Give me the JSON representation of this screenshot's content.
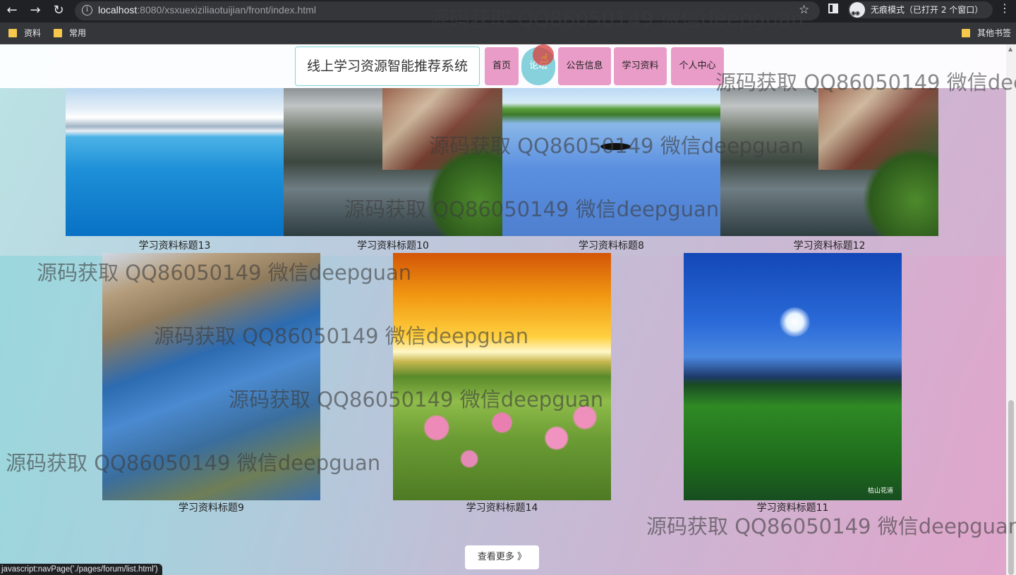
{
  "browser": {
    "url_host": "localhost",
    "url_path": ":8080/xsxuexiziliaotuijian/front/index.html",
    "incognito_label": "无痕模式（已打开 2 个窗口）",
    "bookmarks": [
      "资料",
      "常用"
    ],
    "other_bookmarks": "其他书签",
    "status_text": "javascript:navPage('./pages/forum/list.html')"
  },
  "site": {
    "title": "线上学习资源智能推荐系统",
    "nav": [
      {
        "label": "首页",
        "active": false
      },
      {
        "label": "论坛",
        "active": true
      },
      {
        "label": "公告信息",
        "active": false
      },
      {
        "label": "学习资料",
        "active": false
      },
      {
        "label": "个人中心",
        "active": false
      }
    ]
  },
  "gallery": {
    "row1": [
      {
        "caption": "学习资料标题13",
        "image": "snowy-mountain-lake"
      },
      {
        "caption": "学习资料标题10",
        "image": "lakeside-village"
      },
      {
        "caption": "学习资料标题8",
        "image": "blue-lake-boat"
      },
      {
        "caption": "学习资料标题12",
        "image": "lakeside-village"
      }
    ],
    "row2": [
      {
        "caption": "学习资料标题9",
        "image": "coastline-aerial"
      },
      {
        "caption": "学习资料标题14",
        "image": "sunset-flower-field"
      },
      {
        "caption": "学习资料标题11",
        "image": "night-meadow-moon",
        "mark": "枯山花道"
      }
    ],
    "more_button": "查看更多 》"
  },
  "watermark": "源码获取 QQ86050149 微信deepguan",
  "colors": {
    "nav_pink": "#ea9cc9",
    "nav_active": "#86d1db",
    "title_border": "#86d4d6"
  }
}
